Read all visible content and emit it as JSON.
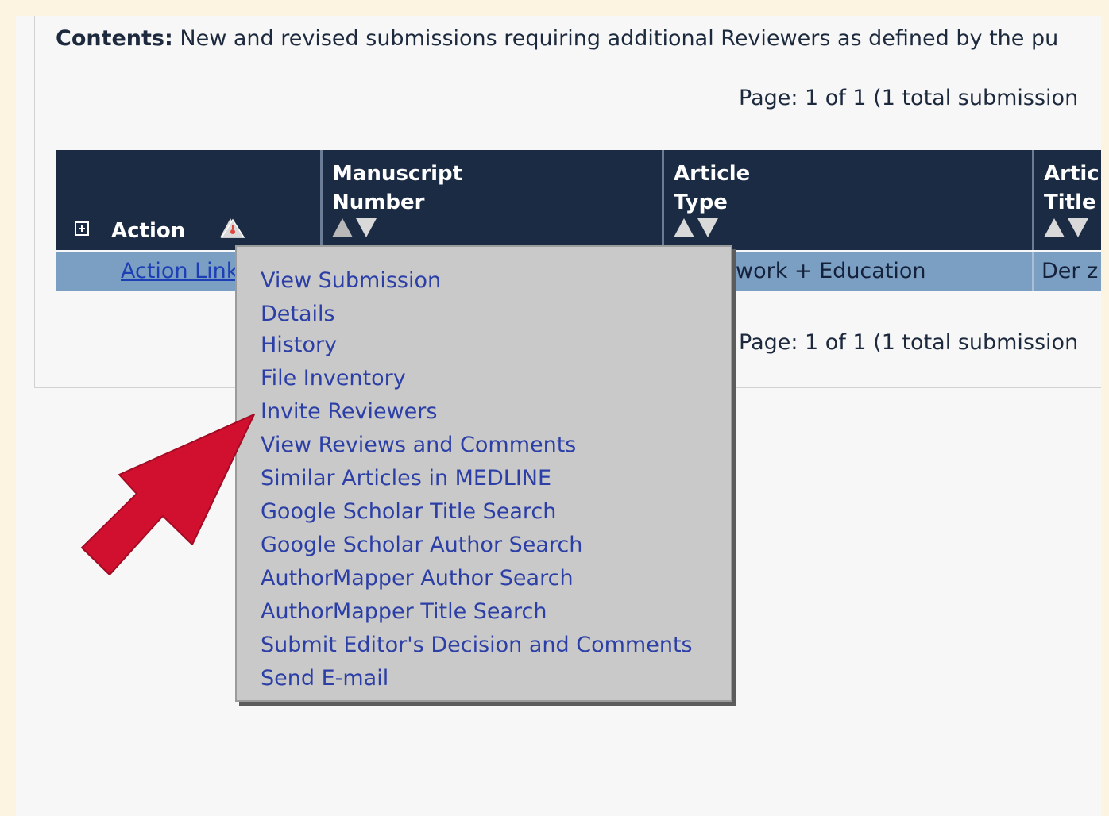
{
  "contents": {
    "label": "Contents:",
    "text": "New and revised submissions requiring additional Reviewers as defined by the pu"
  },
  "pager": {
    "top": "Page: 1 of 1 (1 total submission",
    "bottom": "Page: 1 of 1 (1 total submission"
  },
  "table": {
    "columns": {
      "action": "Action",
      "manuscript_number": "Manuscript\nNumber",
      "article_type": "Article\nType",
      "article_title": "Artic\nTitle"
    },
    "row": {
      "action_link": "Action Links",
      "manuscript_number": "",
      "article_type": "work + Education",
      "article_title": "Der z"
    }
  },
  "action_menu": {
    "items": [
      "View Submission",
      "Details",
      "History",
      "File Inventory",
      "Invite Reviewers",
      "View Reviews and Comments",
      "Similar Articles in MEDLINE",
      "Google Scholar Title Search",
      "Google Scholar Author Search",
      "AuthorMapper Author Search",
      "AuthorMapper Title Search",
      "Submit Editor's Decision and Comments",
      "Send E-mail"
    ]
  },
  "colors": {
    "page_background": "#fdf3e1",
    "header_background": "#1b2b44",
    "row_background": "#7b9ec3",
    "menu_background": "#c9c9c9",
    "link": "#2c3fa6",
    "arrow": "#d0102e"
  },
  "icons": {
    "expand": "plus-box-icon",
    "sort_ascending": "triangle-up-icon",
    "sort_descending": "triangle-down-icon",
    "pointer_arrow": "red-arrow-icon"
  }
}
